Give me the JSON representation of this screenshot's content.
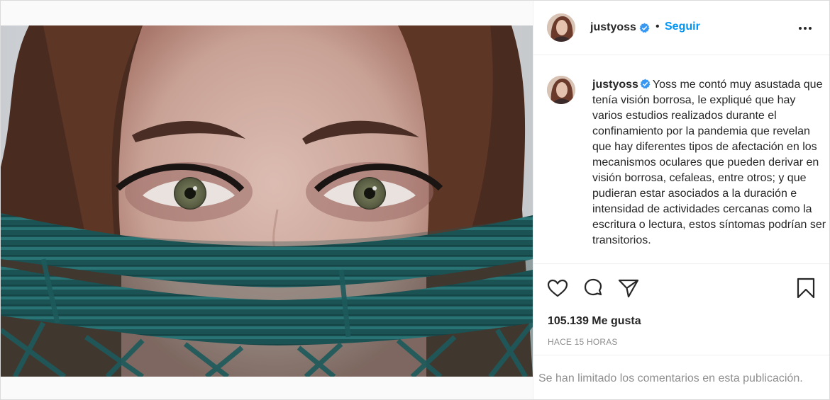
{
  "post": {
    "username": "justyoss",
    "separator": "•",
    "follow_label": "Seguir",
    "caption": "Yoss me contó muy asustada que tenía visión borrosa, le expliqué que hay varios estudios realizados durante el confinamiento por la pandemia que revelan que hay diferentes tipos de afectación en los mecanismos oculares que pueden derivar en visión borrosa, cefaleas, entre otros; y que pudieran estar asociados a la duración e intensidad de actividades cercanas como la escritura o lectura, estos síntomas podrían ser transitorios.",
    "likes": "105.139 Me gusta",
    "timestamp": "HACE 15 HORAS",
    "comments_notice": "Se han limitado los comentarios en esta publicación."
  },
  "icons": {
    "verified": "verified-badge-icon",
    "more": "more-options-icon",
    "like": "heart-icon",
    "comment": "comment-bubble-icon",
    "share": "paper-plane-icon",
    "save": "bookmark-icon"
  },
  "colors": {
    "accent": "#0095f6",
    "text": "#262626",
    "muted": "#8e8e8e",
    "border": "#efefef",
    "net": "#1f5f61"
  }
}
